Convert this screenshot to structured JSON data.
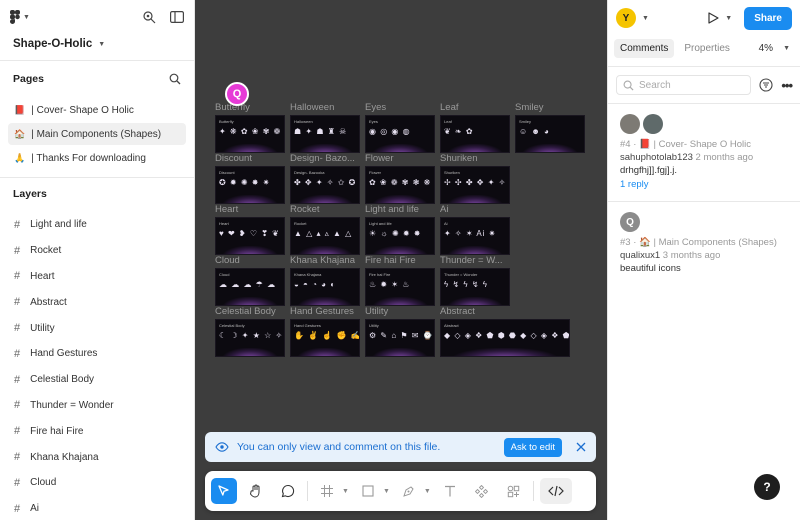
{
  "app": {
    "file_name": "Shape-O-Holic"
  },
  "pages": {
    "title": "Pages",
    "items": [
      {
        "emoji": "📕",
        "label": "| Cover- Shape O Holic"
      },
      {
        "emoji": "🏠",
        "label": "| Main Components (Shapes)"
      },
      {
        "emoji": "🙏",
        "label": "| Thanks For downloading"
      }
    ]
  },
  "layers": {
    "title": "Layers",
    "items": [
      "Light and life",
      "Rocket",
      "Heart",
      "Abstract",
      "Utility",
      "Hand Gestures",
      "Celestial Body",
      "Thunder = Wonder",
      "Fire hai Fire",
      "Khana Khajana",
      "Cloud",
      "Ai"
    ]
  },
  "canvas": {
    "collaborator_initial": "Q",
    "frames": [
      {
        "label": "Butterfly",
        "inner": "Butterfly",
        "glyphs": "✦ ❋ ✿ ❀ ✾ ❁"
      },
      {
        "label": "Halloween",
        "inner": "Halloween",
        "glyphs": "☗ ✦ ☗ ♜ ☠"
      },
      {
        "label": "Eyes",
        "inner": "Eyes",
        "glyphs": "◉ ◎ ◉ ◍"
      },
      {
        "label": "Leaf",
        "inner": "Leaf",
        "glyphs": "❦ ❧ ✿"
      },
      {
        "label": "Smiley",
        "inner": "Smiley",
        "glyphs": "☺ ☻ ◕"
      },
      {
        "label": "Discount",
        "inner": "Discount",
        "glyphs": "✪ ✹ ✺ ✸ ✷"
      },
      {
        "label": "Design- Bazo...",
        "inner": "Design- Bazooka",
        "glyphs": "✤ ✥ ✦ ✧ ✩ ✪ ✫ ✬ ✭ ✮"
      },
      {
        "label": "Flower",
        "inner": "Flower",
        "glyphs": "✿ ❀ ❁ ✾ ❃ ❋"
      },
      {
        "label": "Shuriken",
        "inner": "Shuriken",
        "glyphs": "✢ ✣ ✤ ✥ ✦ ✧ ✩"
      },
      {
        "label": "Heart",
        "inner": "Heart",
        "glyphs": "♥ ❤ ❥ ♡ ❣ ❦"
      },
      {
        "label": "Rocket",
        "inner": "Rocket",
        "glyphs": "▲ △ ▴ ▵ ▲ △"
      },
      {
        "label": "Light and life",
        "inner": "Light and life",
        "glyphs": "☀ ☼ ✺ ✹ ✸"
      },
      {
        "label": "Ai",
        "inner": "Ai",
        "glyphs": "✦ ✧ ✶ Ai ✷"
      },
      {
        "label": "Cloud",
        "inner": "Cloud",
        "glyphs": "☁ ☁ ☁ ☂ ☁"
      },
      {
        "label": "Khana Khajana",
        "inner": "Khana Khajana",
        "glyphs": "◒ ◓ ◔ ◕ ◐"
      },
      {
        "label": "Fire hai Fire",
        "inner": "Fire hai Fire",
        "glyphs": "♨ ✹ ✶ ♨"
      },
      {
        "label": "Thunder = W...",
        "inner": "Thunder = Wonder",
        "glyphs": "ϟ ↯ ϟ ↯ ϟ"
      },
      {
        "label": "Celestial Body",
        "inner": "Celestial Body",
        "glyphs": "☾ ☽ ✦ ★ ☆ ✧"
      },
      {
        "label": "Hand Gestures",
        "inner": "Hand Gestures",
        "glyphs": "✋ ✌ ☝ ✊ ✍"
      },
      {
        "label": "Utility",
        "inner": "Utility",
        "glyphs": "⚙ ✎ ⌂ ⚑ ✉ ⌚ ☎ ⚐"
      },
      {
        "label": "Abstract",
        "inner": "Abstract",
        "glyphs": "◆ ◇ ◈ ❖ ⬟ ⬢ ⬣ ◆ ◇ ◈ ❖ ⬟"
      }
    ]
  },
  "banner": {
    "text": "You can only view and comment on this file.",
    "action": "Ask to edit"
  },
  "right": {
    "user_initial": "Y",
    "share_label": "Share",
    "tabs": [
      "Comments",
      "Properties"
    ],
    "zoom": "4%",
    "search_placeholder": "Search",
    "comments": [
      {
        "meta": "#4 · 📕 | Cover- Shape O Holic",
        "user": "sahuphotolab123",
        "time": "2 months ago",
        "body": "drhgfhj]].fgj].j.",
        "reply": "1 reply"
      },
      {
        "initial": "Q",
        "meta": "#3 · 🏠 | Main Components (Shapes)",
        "user": "qualixux1",
        "time": "3 months ago",
        "body": "beautiful icons"
      }
    ]
  },
  "help_label": "?"
}
